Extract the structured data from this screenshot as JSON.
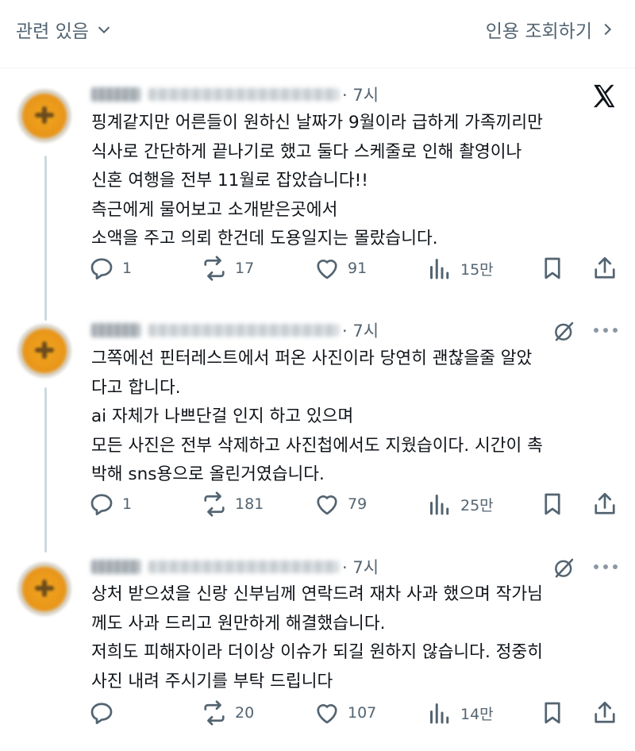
{
  "topbar": {
    "related_label": "관련 있음",
    "quote_label": "인용 조회하기"
  },
  "posts": [
    {
      "time": "· 7시",
      "text": "핑계같지만 어른들이 원하신 날짜가 9월이라 급하게 가족끼리만\n식사로 간단하게 끝나기로 했고 둘다 스케줄로 인해 촬영이나\n신혼 여행을 전부 11월로 잡았습니다!!\n측근에게 물어보고 소개받은곳에서\n소액을 주고 의뢰 한건데 도용일지는 몰랐습니다.",
      "replies": "1",
      "reposts": "17",
      "likes": "91",
      "views": "15만"
    },
    {
      "time": "· 7시",
      "text": "그쪽에선 핀터레스트에서 퍼온 사진이라 당연히 괜찮을줄 알았\n다고 합니다.\nai 자체가 나쁘단걸 인지 하고 있으며\n모든 사진은 전부 삭제하고 사진첩에서도 지웠습이다. 시간이 촉\n박해 sns용으로 올린거였습니다.",
      "replies": "1",
      "reposts": "181",
      "likes": "79",
      "views": "25만"
    },
    {
      "time": "· 7시",
      "text": "상처 받으셨을 신랑 신부님께 연락드려 재차 사과 했으며 작가님\n께도 사과 드리고 원만하게 해결했습니다.\n저희도 피해자이라 더이상 이슈가 되길 원하지 않습니다. 정중히\n사진 내려 주시기를 부탁 드립니다",
      "replies": "",
      "reposts": "20",
      "likes": "107",
      "views": "14만"
    }
  ],
  "icons": {
    "reply": "reply-icon",
    "repost": "repost-icon",
    "like": "heart-icon",
    "views": "views-icon",
    "bookmark": "bookmark-icon",
    "share": "share-icon",
    "grok": "grok-icon",
    "more": "more-icon",
    "x": "x-logo"
  },
  "colors": {
    "secondary_text": "#536471",
    "primary_text": "#0f1419",
    "thread_line": "#cfd9de"
  }
}
